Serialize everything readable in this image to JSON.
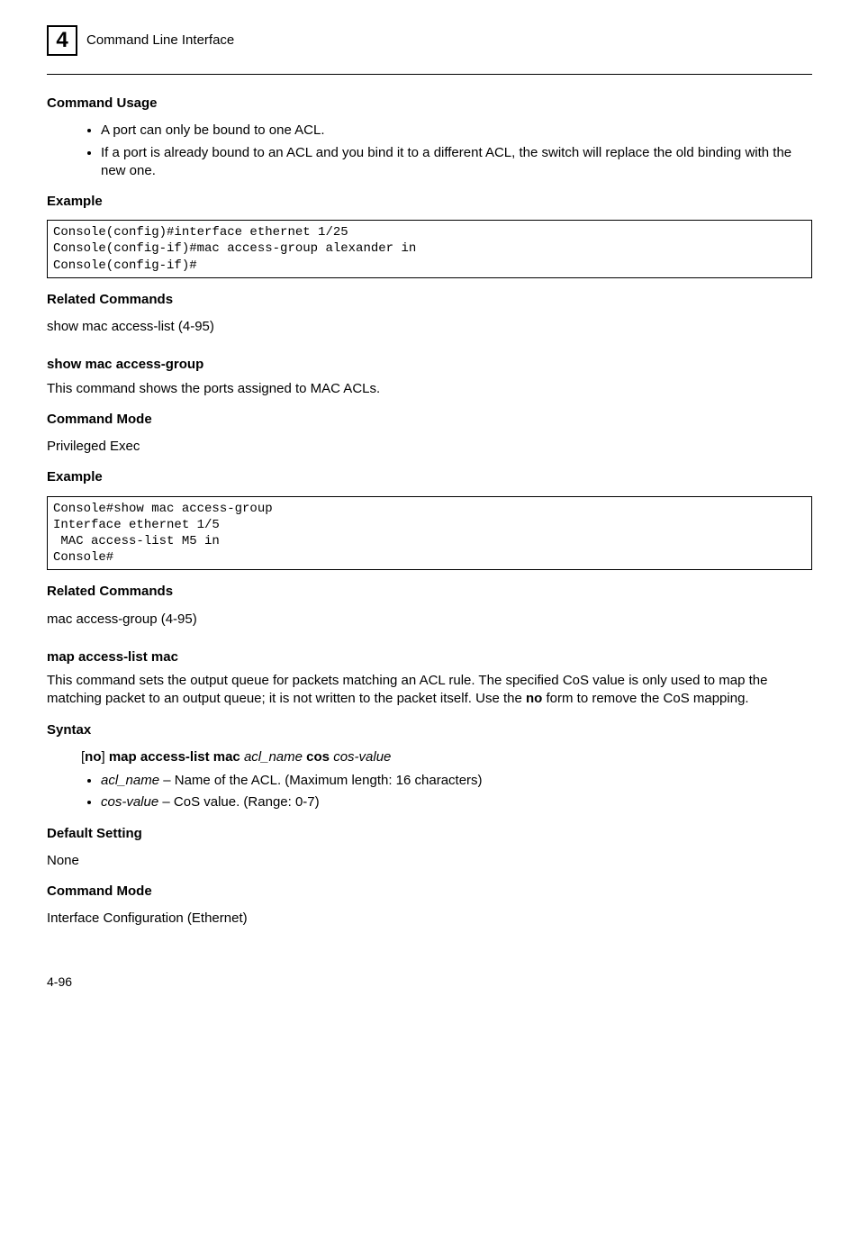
{
  "header": {
    "chapter_num": "4",
    "title": "Command Line Interface"
  },
  "s_cmd_usage": {
    "title": "Command Usage",
    "items": [
      "A port can only be bound to one ACL.",
      "If a port is already bound to an ACL and you bind it to a different ACL, the switch will replace the old binding with the new one."
    ]
  },
  "s_ex1": {
    "title": "Example",
    "code": "Console(config)#interface ethernet 1/25\nConsole(config-if)#mac access-group alexander in\nConsole(config-if)#"
  },
  "s_related1": {
    "title": "Related Commands",
    "text": "show mac access-list (4-95)"
  },
  "s_show_mac_ag": {
    "title": "show mac access-group",
    "desc": "This command shows the ports assigned to MAC ACLs."
  },
  "s_cmd_mode1": {
    "title": "Command Mode",
    "text": "Privileged Exec"
  },
  "s_ex2": {
    "title": "Example",
    "code": "Console#show mac access-group\nInterface ethernet 1/5\n MAC access-list M5 in\nConsole#"
  },
  "s_related2": {
    "title": "Related Commands",
    "text": "mac access-group (4-95)"
  },
  "s_map_al_mac": {
    "title": "map access-list mac",
    "desc_prefix": "This command sets the output queue for packets matching an ACL rule. The specified CoS value is only used to map the matching packet to an output queue; it is not written to the packet itself. Use the ",
    "desc_bold": "no",
    "desc_suffix": " form to remove the CoS mapping."
  },
  "s_syntax": {
    "title": "Syntax",
    "line": {
      "br1": "[",
      "no": "no",
      "br2": "] ",
      "cmd": "map access-list mac",
      "sp1": " ",
      "p1": "acl_name",
      "sp2": " ",
      "cos_kw": "cos",
      "sp3": " ",
      "p2": "cos-value"
    },
    "items": [
      {
        "param": "acl_name",
        "sep": " – ",
        "text": "Name of the ACL. (Maximum length: 16 characters)"
      },
      {
        "param": "cos-value",
        "sep": " – ",
        "text": "CoS value. (Range: 0-7)"
      }
    ]
  },
  "s_default": {
    "title": "Default Setting",
    "text": "None"
  },
  "s_cmd_mode2": {
    "title": "Command Mode",
    "text": "Interface Configuration (Ethernet)"
  },
  "footer": {
    "page": "4-96"
  }
}
